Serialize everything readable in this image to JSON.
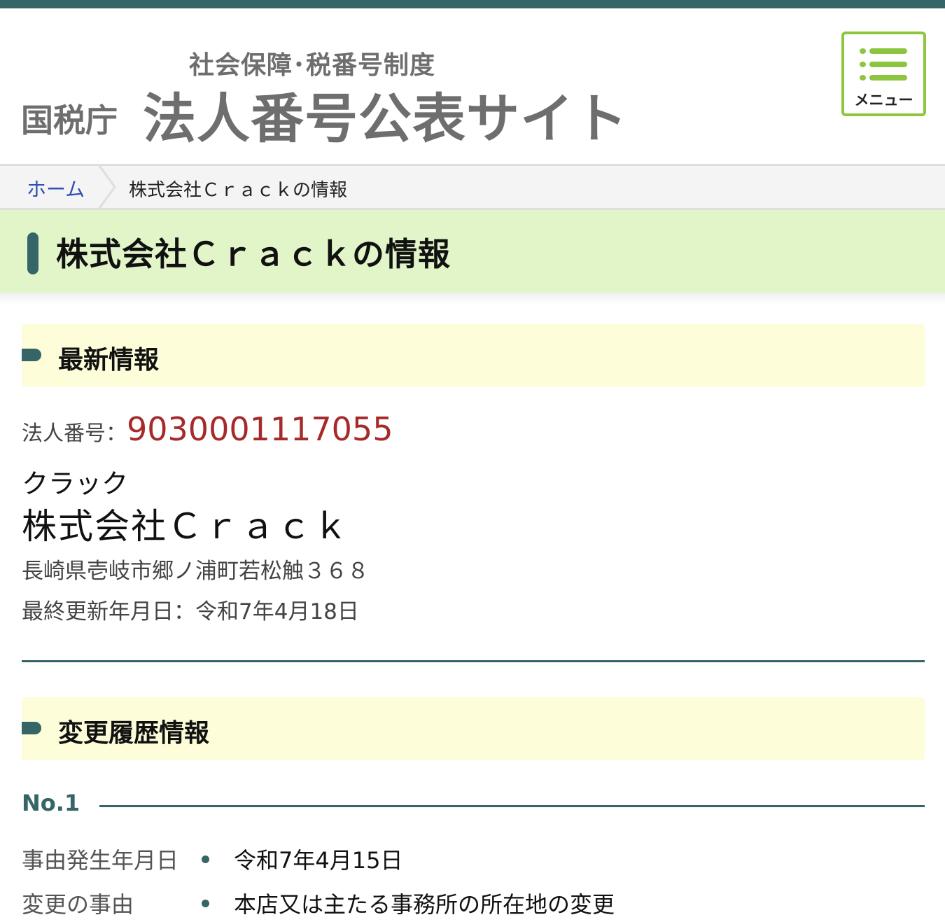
{
  "header": {
    "subtitle": "社会保障･税番号制度",
    "agency": "国税庁",
    "title": "法人番号公表サイト",
    "menu_label": "メニュー"
  },
  "breadcrumb": {
    "home": "ホーム",
    "current": "株式会社Ｃｒａｃｋの情報"
  },
  "page_title": "株式会社Ｃｒａｃｋの情報",
  "latest": {
    "heading": "最新情報",
    "number_label": "法人番号：",
    "number_value": "9030001117055",
    "kana": "クラック",
    "name": "株式会社Ｃｒａｃｋ",
    "address": "長崎県壱岐市郷ノ浦町若松触３６８",
    "updated": "最終更新年月日：令和7年4月18日"
  },
  "history": {
    "heading": "変更履歴情報",
    "records": [
      {
        "no": "No.1",
        "fields": [
          {
            "label": "事由発生年月日",
            "value": "令和7年4月15日"
          },
          {
            "label": "変更の事由",
            "value": "本店又は主たる事務所の所在地の変更"
          }
        ]
      }
    ]
  },
  "colors": {
    "theme_dark": "#356566",
    "menu_green": "#8cc63f",
    "title_band": "#e2f5c8",
    "section_band": "#fefdd9",
    "number_red": "#a52a2a",
    "link_blue": "#2f4fb3"
  },
  "icons": {
    "menu": "hamburger-list-icon",
    "breadcrumb_separator": "chevron-right-icon"
  }
}
